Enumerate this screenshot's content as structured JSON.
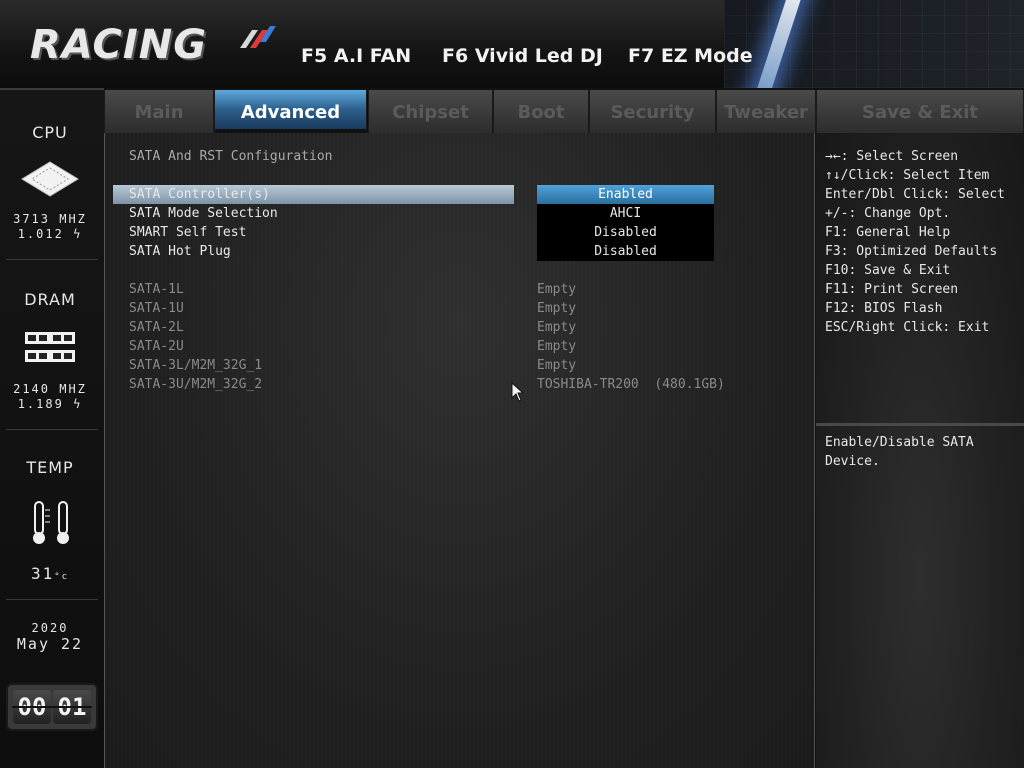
{
  "header": {
    "logo_text": "RACING",
    "hotkeys": [
      {
        "label": "F5 A.I FAN"
      },
      {
        "label": "F6 Vivid Led DJ"
      },
      {
        "label": "F7 EZ Mode"
      }
    ]
  },
  "left_panel": {
    "cpu": {
      "title": "CPU",
      "freq": "3713 MHZ",
      "volt": "1.012"
    },
    "dram": {
      "title": "DRAM",
      "freq": "2140 MHZ",
      "volt": "1.189"
    },
    "temp": {
      "title": "TEMP",
      "value": "31",
      "unit": "°c"
    },
    "date": {
      "year": "2020",
      "month_day": "May 22"
    },
    "clock": {
      "hours": "00",
      "minutes": "01"
    }
  },
  "tabs": [
    {
      "label": "Main",
      "active": false
    },
    {
      "label": "Advanced",
      "active": true
    },
    {
      "label": "Chipset",
      "active": false
    },
    {
      "label": "Boot",
      "active": false
    },
    {
      "label": "Security",
      "active": false
    },
    {
      "label": "Tweaker",
      "active": false
    },
    {
      "label": "Save & Exit",
      "active": false
    }
  ],
  "main": {
    "section_title": "SATA And RST Configuration",
    "settings": [
      {
        "label": "SATA Controller(s)",
        "value": "Enabled",
        "selected": true
      },
      {
        "label": "SATA Mode Selection",
        "value": "AHCI",
        "selected": false
      },
      {
        "label": "SMART Self Test",
        "value": "Disabled",
        "selected": false
      },
      {
        "label": "SATA Hot Plug",
        "value": "Disabled",
        "selected": false
      }
    ],
    "devices": [
      {
        "port": "SATA-1L",
        "device": "Empty"
      },
      {
        "port": "SATA-1U",
        "device": "Empty"
      },
      {
        "port": "SATA-2L",
        "device": "Empty"
      },
      {
        "port": "SATA-2U",
        "device": "Empty"
      },
      {
        "port": "SATA-3L/M2M_32G_1",
        "device": "Empty"
      },
      {
        "port": "SATA-3U/M2M_32G_2",
        "device": "TOSHIBA-TR200  (480.1GB)"
      }
    ]
  },
  "help": {
    "lines": [
      "→←: Select Screen",
      "↑↓/Click: Select Item",
      "Enter/Dbl Click: Select",
      "+/-: Change Opt.",
      "F1: General Help",
      "F3: Optimized Defaults",
      "F10: Save & Exit",
      "F11: Print Screen",
      "F12: BIOS Flash",
      "ESC/Right Click: Exit"
    ],
    "description": "Enable/Disable SATA Device."
  },
  "colors": {
    "accent_blue": "#4fa3da",
    "highlight_row": "#9fb4c5"
  }
}
